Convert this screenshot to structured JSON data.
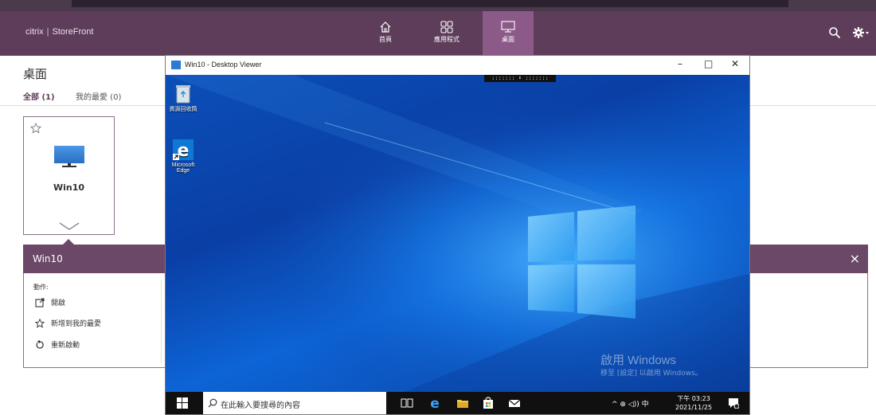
{
  "header": {
    "brand_citrix": "citrix",
    "brand_store": "StoreFront",
    "tabs": [
      {
        "label": "首頁",
        "icon": "home-icon"
      },
      {
        "label": "應用程式",
        "icon": "apps-icon"
      },
      {
        "label": "桌面",
        "icon": "desktop-icon"
      }
    ],
    "colors": {
      "bar": "#5e3d5a",
      "active_tab": "#8c5a88"
    }
  },
  "page": {
    "title": "桌面",
    "filter_all": "全部 (1)",
    "filter_favorites": "我的最愛 (0)"
  },
  "card": {
    "name": "Win10"
  },
  "details": {
    "title": "Win10",
    "actions_label": "動作:",
    "actions": [
      {
        "label": "開啟",
        "icon": "open-icon"
      },
      {
        "label": "新增到我的最愛",
        "icon": "star-icon"
      },
      {
        "label": "重新啟動",
        "icon": "restart-icon"
      }
    ],
    "close": "×"
  },
  "viewer": {
    "title": "Win10 - Desktop Viewer",
    "minimize": "–",
    "maximize": "□",
    "close": "✕",
    "toolbar_handle": "::::::: ⬇ :::::::",
    "desktop_icons": [
      {
        "label": "資源回收筒",
        "icon": "recycle-bin-icon"
      },
      {
        "label": "Microsoft Edge",
        "icon": "edge-icon"
      }
    ],
    "watermark_title": "啟用 Windows",
    "watermark_sub": "移至 [設定] 以啟用 Windows。",
    "taskbar": {
      "search_placeholder": "在此輸入要搜尋的內容",
      "tray": "^ ⊕ ◁)) 中",
      "time": "下午 03:23",
      "date": "2021/11/25"
    }
  }
}
